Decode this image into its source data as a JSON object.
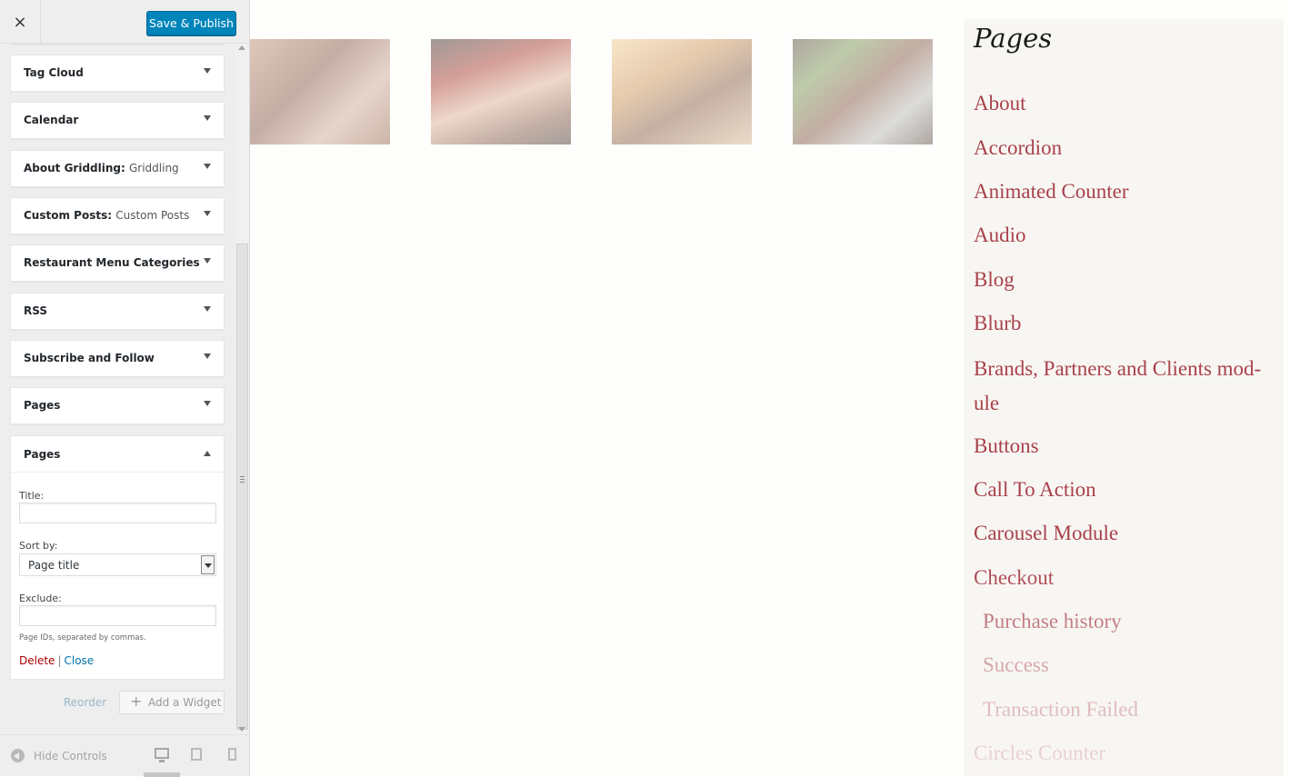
{
  "header": {
    "close_icon": "×",
    "publish_label": "Save & Publish"
  },
  "widgets": [
    {
      "title": "Tag Cloud",
      "subtitle": ""
    },
    {
      "title": "Calendar",
      "subtitle": ""
    },
    {
      "title": "About Griddling:",
      "subtitle": "Griddling"
    },
    {
      "title": "Custom Posts:",
      "subtitle": "Custom Posts"
    },
    {
      "title": "Restaurant Menu Categories",
      "subtitle": ""
    },
    {
      "title": "RSS",
      "subtitle": ""
    },
    {
      "title": "Subscribe and Follow",
      "subtitle": ""
    },
    {
      "title": "Pages",
      "subtitle": ""
    }
  ],
  "open_widget": {
    "title": "Pages",
    "title_label": "Title:",
    "title_value": "",
    "sort_label": "Sort by:",
    "sort_value": "Page title",
    "exclude_label": "Exclude:",
    "exclude_value": "",
    "exclude_help": "Page IDs, separated by commas.",
    "delete_label": "Delete",
    "separator": "|",
    "close_label": "Close"
  },
  "actions": {
    "reorder_label": "Reorder",
    "add_widget_icon": "+",
    "add_widget_label": "Add a Widget"
  },
  "footer": {
    "hide_controls_label": "Hide Controls",
    "devices": [
      "desktop-icon",
      "tablet-icon",
      "mobile-icon"
    ],
    "active_device": "desktop"
  },
  "preview": {
    "thumbnails": [
      "grilled-ribs",
      "steak-with-chili",
      "grilled-steak-lemon",
      "steak-with-herbs"
    ],
    "pages_title": "Pages",
    "pages": [
      {
        "label": "About",
        "child": false
      },
      {
        "label": "Accordion",
        "child": false
      },
      {
        "label": "Animated Counter",
        "child": false
      },
      {
        "label": "Audio",
        "child": false
      },
      {
        "label": "Blog",
        "child": false
      },
      {
        "label": "Blurb",
        "child": false
      },
      {
        "label": "Brands, Partners and Clients mod-ule",
        "child": false
      },
      {
        "label": "Buttons",
        "child": false
      },
      {
        "label": "Call To Action",
        "child": false
      },
      {
        "label": "Carousel Module",
        "child": false
      },
      {
        "label": "Checkout",
        "child": false
      },
      {
        "label": "Purchase history",
        "child": true
      },
      {
        "label": "Success",
        "child": true
      },
      {
        "label": "Transaction Failed",
        "child": true
      },
      {
        "label": "Circles Counter",
        "child": false
      }
    ]
  },
  "colors": {
    "primary_button": "#0085ba",
    "link_color": "#a8414b",
    "delete_color": "#aa0000",
    "close_color": "#0073aa"
  }
}
